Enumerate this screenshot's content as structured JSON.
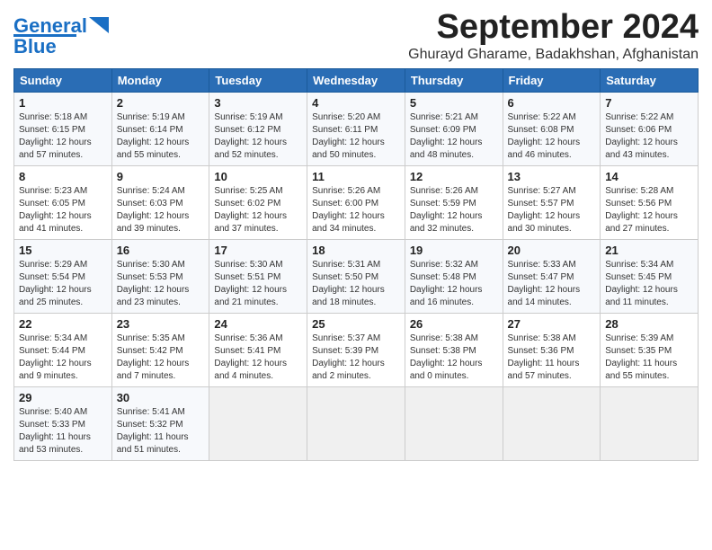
{
  "header": {
    "logo_line1": "General",
    "logo_line2": "Blue",
    "month_title": "September 2024",
    "subtitle": "Ghurayd Gharame, Badakhshan, Afghanistan"
  },
  "days_of_week": [
    "Sunday",
    "Monday",
    "Tuesday",
    "Wednesday",
    "Thursday",
    "Friday",
    "Saturday"
  ],
  "weeks": [
    [
      {
        "day": "1",
        "info": "Sunrise: 5:18 AM\nSunset: 6:15 PM\nDaylight: 12 hours\nand 57 minutes."
      },
      {
        "day": "2",
        "info": "Sunrise: 5:19 AM\nSunset: 6:14 PM\nDaylight: 12 hours\nand 55 minutes."
      },
      {
        "day": "3",
        "info": "Sunrise: 5:19 AM\nSunset: 6:12 PM\nDaylight: 12 hours\nand 52 minutes."
      },
      {
        "day": "4",
        "info": "Sunrise: 5:20 AM\nSunset: 6:11 PM\nDaylight: 12 hours\nand 50 minutes."
      },
      {
        "day": "5",
        "info": "Sunrise: 5:21 AM\nSunset: 6:09 PM\nDaylight: 12 hours\nand 48 minutes."
      },
      {
        "day": "6",
        "info": "Sunrise: 5:22 AM\nSunset: 6:08 PM\nDaylight: 12 hours\nand 46 minutes."
      },
      {
        "day": "7",
        "info": "Sunrise: 5:22 AM\nSunset: 6:06 PM\nDaylight: 12 hours\nand 43 minutes."
      }
    ],
    [
      {
        "day": "8",
        "info": "Sunrise: 5:23 AM\nSunset: 6:05 PM\nDaylight: 12 hours\nand 41 minutes."
      },
      {
        "day": "9",
        "info": "Sunrise: 5:24 AM\nSunset: 6:03 PM\nDaylight: 12 hours\nand 39 minutes."
      },
      {
        "day": "10",
        "info": "Sunrise: 5:25 AM\nSunset: 6:02 PM\nDaylight: 12 hours\nand 37 minutes."
      },
      {
        "day": "11",
        "info": "Sunrise: 5:26 AM\nSunset: 6:00 PM\nDaylight: 12 hours\nand 34 minutes."
      },
      {
        "day": "12",
        "info": "Sunrise: 5:26 AM\nSunset: 5:59 PM\nDaylight: 12 hours\nand 32 minutes."
      },
      {
        "day": "13",
        "info": "Sunrise: 5:27 AM\nSunset: 5:57 PM\nDaylight: 12 hours\nand 30 minutes."
      },
      {
        "day": "14",
        "info": "Sunrise: 5:28 AM\nSunset: 5:56 PM\nDaylight: 12 hours\nand 27 minutes."
      }
    ],
    [
      {
        "day": "15",
        "info": "Sunrise: 5:29 AM\nSunset: 5:54 PM\nDaylight: 12 hours\nand 25 minutes."
      },
      {
        "day": "16",
        "info": "Sunrise: 5:30 AM\nSunset: 5:53 PM\nDaylight: 12 hours\nand 23 minutes."
      },
      {
        "day": "17",
        "info": "Sunrise: 5:30 AM\nSunset: 5:51 PM\nDaylight: 12 hours\nand 21 minutes."
      },
      {
        "day": "18",
        "info": "Sunrise: 5:31 AM\nSunset: 5:50 PM\nDaylight: 12 hours\nand 18 minutes."
      },
      {
        "day": "19",
        "info": "Sunrise: 5:32 AM\nSunset: 5:48 PM\nDaylight: 12 hours\nand 16 minutes."
      },
      {
        "day": "20",
        "info": "Sunrise: 5:33 AM\nSunset: 5:47 PM\nDaylight: 12 hours\nand 14 minutes."
      },
      {
        "day": "21",
        "info": "Sunrise: 5:34 AM\nSunset: 5:45 PM\nDaylight: 12 hours\nand 11 minutes."
      }
    ],
    [
      {
        "day": "22",
        "info": "Sunrise: 5:34 AM\nSunset: 5:44 PM\nDaylight: 12 hours\nand 9 minutes."
      },
      {
        "day": "23",
        "info": "Sunrise: 5:35 AM\nSunset: 5:42 PM\nDaylight: 12 hours\nand 7 minutes."
      },
      {
        "day": "24",
        "info": "Sunrise: 5:36 AM\nSunset: 5:41 PM\nDaylight: 12 hours\nand 4 minutes."
      },
      {
        "day": "25",
        "info": "Sunrise: 5:37 AM\nSunset: 5:39 PM\nDaylight: 12 hours\nand 2 minutes."
      },
      {
        "day": "26",
        "info": "Sunrise: 5:38 AM\nSunset: 5:38 PM\nDaylight: 12 hours\nand 0 minutes."
      },
      {
        "day": "27",
        "info": "Sunrise: 5:38 AM\nSunset: 5:36 PM\nDaylight: 11 hours\nand 57 minutes."
      },
      {
        "day": "28",
        "info": "Sunrise: 5:39 AM\nSunset: 5:35 PM\nDaylight: 11 hours\nand 55 minutes."
      }
    ],
    [
      {
        "day": "29",
        "info": "Sunrise: 5:40 AM\nSunset: 5:33 PM\nDaylight: 11 hours\nand 53 minutes."
      },
      {
        "day": "30",
        "info": "Sunrise: 5:41 AM\nSunset: 5:32 PM\nDaylight: 11 hours\nand 51 minutes."
      },
      {
        "day": "",
        "info": ""
      },
      {
        "day": "",
        "info": ""
      },
      {
        "day": "",
        "info": ""
      },
      {
        "day": "",
        "info": ""
      },
      {
        "day": "",
        "info": ""
      }
    ]
  ]
}
